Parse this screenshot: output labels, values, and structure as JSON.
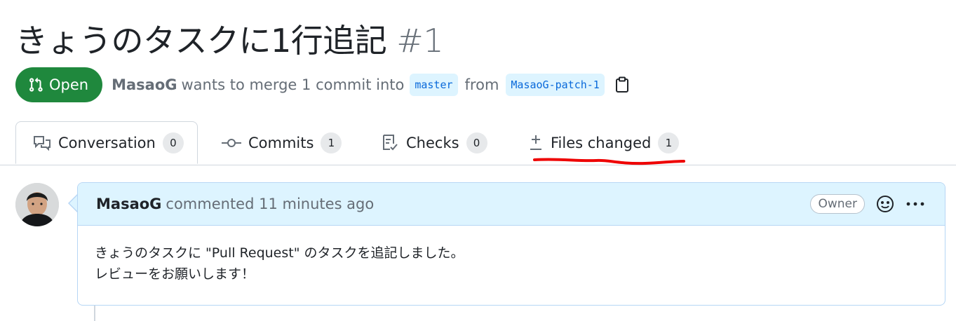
{
  "pr": {
    "title": "きょうのタスクに1行追記",
    "number": "#1",
    "state": "Open",
    "author": "MasaoG",
    "merge_text": "wants to merge 1 commit into",
    "base_branch": "master",
    "from_text": "from",
    "head_branch": "MasaoG-patch-1"
  },
  "tabs": [
    {
      "label": "Conversation",
      "count": "0",
      "icon": "comment-discussion-icon",
      "active": true
    },
    {
      "label": "Commits",
      "count": "1",
      "icon": "git-commit-icon",
      "active": false
    },
    {
      "label": "Checks",
      "count": "0",
      "icon": "checklist-icon",
      "active": false
    },
    {
      "label": "Files changed",
      "count": "1",
      "icon": "diff-icon",
      "active": false
    }
  ],
  "comment": {
    "author": "MasaoG",
    "action": "commented 11 minutes ago",
    "badge": "Owner",
    "body_line1": "きょうのタスクに \"Pull Request\" のタスクを追記しました。",
    "body_line2": "レビューをお願いします！"
  },
  "colors": {
    "open_green": "#1f883d",
    "branch_blue": "#0969da",
    "annotation_red": "#ee0000"
  }
}
